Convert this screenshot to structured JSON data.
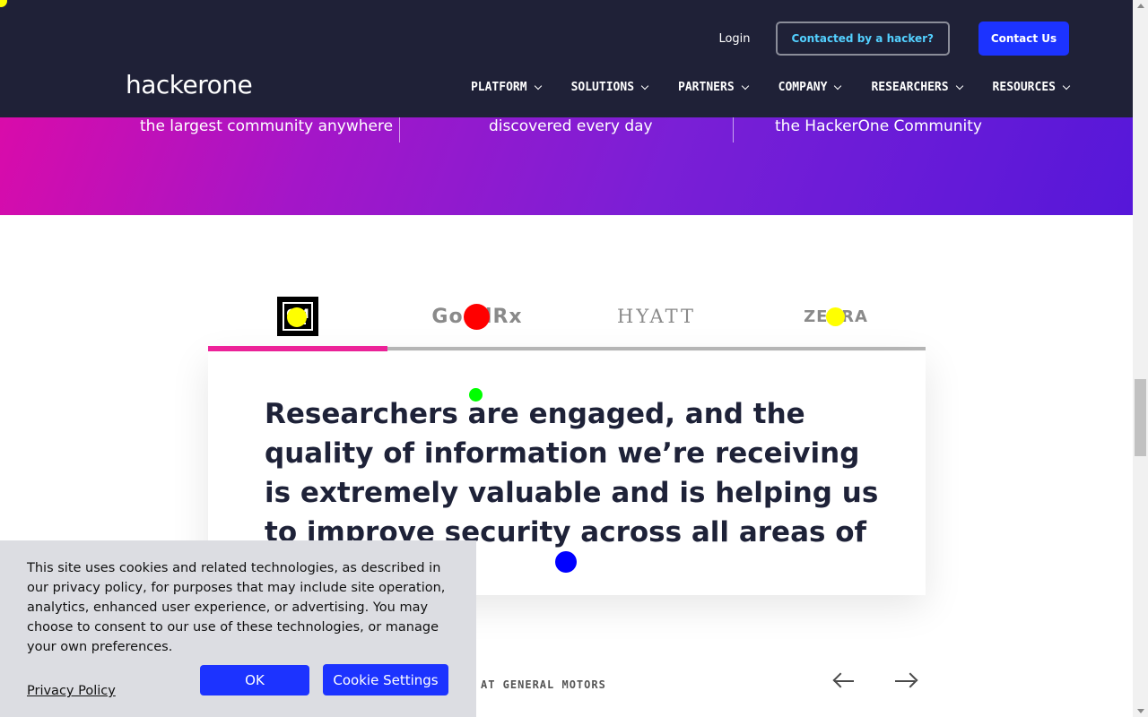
{
  "header": {
    "logo": "hackerone",
    "login": "Login",
    "contacted_button": "Contacted by a hacker?",
    "contact_button": "Contact Us",
    "nav": [
      "PLATFORM",
      "SOLUTIONS",
      "PARTNERS",
      "COMPANY",
      "RESEARCHERS",
      "RESOURCES"
    ]
  },
  "stats": [
    "the largest community anywhere",
    "discovered every day",
    "the HackerOne Community"
  ],
  "tabs": {
    "items": [
      "GM",
      "GoodRx",
      "HYATT",
      "ZEBRA"
    ],
    "active": "GM"
  },
  "quote": {
    "text": "Researchers are engaged, and the quality of information we’re receiving is extremely valuable and is helping us to improve security across all areas of GM."
  },
  "case_label": "AT GENERAL MOTORS",
  "cookie": {
    "text": "This site uses cookies and related technologies, as described in our privacy policy, for purposes that may include site operation, analytics, enhanced user experience, or advertising. You may choose to consent to our use of these technologies, or manage your own preferences.",
    "privacy_link": "Privacy Policy",
    "ok_button": "OK",
    "settings_button": "Cookie Settings"
  },
  "colors": {
    "header_bg": "#1f2137",
    "accent_blue": "#1c33ff",
    "tab_active": "#f1239c",
    "outline_text": "#53d0ff"
  },
  "icons": [
    "chevron-down-icon",
    "arrow-left-icon",
    "arrow-right-icon"
  ]
}
